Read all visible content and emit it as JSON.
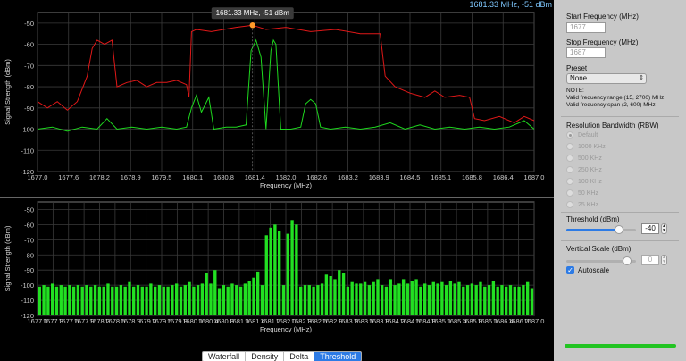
{
  "readout": "1681.33 MHz, -51 dBm",
  "tabs": [
    {
      "label": "Waterfall",
      "active": false
    },
    {
      "label": "Density",
      "active": false
    },
    {
      "label": "Delta",
      "active": false
    },
    {
      "label": "Threshold",
      "active": true
    }
  ],
  "panel": {
    "start_label": "Start Frequency (MHz)",
    "start_placeholder": "1677",
    "stop_label": "Stop Frequency (MHz)",
    "stop_placeholder": "1687",
    "preset_label": "Preset",
    "preset_value": "None",
    "note_title": "NOTE:",
    "note_line1": "Valid frequency range (15, 2700) MHz",
    "note_line2": "Valid frequency span (2, 600) MHz",
    "rbw_label": "Resolution Bandwidth (RBW)",
    "rbw_options": [
      "Default",
      "1000 KHz",
      "500 KHz",
      "250 KHz",
      "100 KHz",
      "50 KHz",
      "25 KHz"
    ],
    "rbw_selected": 0,
    "threshold_label": "Threshold (dBm)",
    "threshold_value": "-40",
    "threshold_level": 0.75,
    "vscale_label": "Vertical Scale (dBm)",
    "vscale_value": "0",
    "vscale_level": 0.87,
    "autoscale_label": "Autoscale",
    "autoscale_checked": true
  },
  "chart_data": [
    {
      "type": "line",
      "tooltip": "1681.33 MHz, -51 dBm",
      "marker": {
        "x": 1681.33,
        "y": -51
      },
      "xlabel": "Frequency (MHz)",
      "ylabel": "Signal Strength (dBm)",
      "xlim": [
        1677.0,
        1687.0
      ],
      "ylim": [
        -120,
        -45
      ],
      "xticks": [
        "1677.0",
        "1677.6",
        "1678.2",
        "1678.9",
        "1679.5",
        "1680.1",
        "1680.8",
        "1681.4",
        "1682.0",
        "1682.6",
        "1683.2",
        "1683.9",
        "1684.5",
        "1685.1",
        "1685.8",
        "1686.4",
        "1687.0"
      ],
      "yticks": [
        -50,
        -60,
        -70,
        -80,
        -90,
        -100,
        -110,
        -120
      ],
      "grid": true,
      "series": [
        {
          "color": "#e01818",
          "x": [
            1677.0,
            1677.2,
            1677.4,
            1677.6,
            1677.8,
            1678.0,
            1678.1,
            1678.2,
            1678.35,
            1678.5,
            1678.6,
            1678.8,
            1679.0,
            1679.2,
            1679.4,
            1679.6,
            1679.8,
            1680.0,
            1680.05,
            1680.1,
            1680.2,
            1680.5,
            1681.0,
            1681.33,
            1681.6,
            1682.0,
            1682.5,
            1683.0,
            1683.5,
            1683.9,
            1684.0,
            1684.2,
            1684.5,
            1684.8,
            1685.0,
            1685.2,
            1685.5,
            1685.7,
            1685.8,
            1686.0,
            1686.3,
            1686.6,
            1686.8,
            1687.0
          ],
          "y": [
            -87,
            -90,
            -87,
            -91,
            -87,
            -75,
            -62,
            -58,
            -60,
            -58,
            -80,
            -78,
            -77,
            -80,
            -78,
            -78,
            -77,
            -79,
            -85,
            -54,
            -53,
            -54,
            -52,
            -51,
            -53,
            -52,
            -54,
            -53,
            -55,
            -55,
            -75,
            -80,
            -83,
            -85,
            -82,
            -85,
            -84,
            -85,
            -95,
            -96,
            -94,
            -97,
            -94,
            -96
          ]
        },
        {
          "color": "#1ed81e",
          "x": [
            1677.0,
            1677.3,
            1677.6,
            1677.9,
            1678.2,
            1678.4,
            1678.6,
            1678.9,
            1679.2,
            1679.5,
            1679.8,
            1680.0,
            1680.1,
            1680.2,
            1680.3,
            1680.45,
            1680.55,
            1680.8,
            1681.0,
            1681.2,
            1681.3,
            1681.4,
            1681.5,
            1681.6,
            1681.7,
            1681.75,
            1681.8,
            1681.9,
            1682.1,
            1682.3,
            1682.4,
            1682.5,
            1682.6,
            1682.7,
            1682.9,
            1683.2,
            1683.5,
            1683.8,
            1684.1,
            1684.4,
            1684.7,
            1685.0,
            1685.3,
            1685.6,
            1685.9,
            1686.2,
            1686.5,
            1686.8,
            1687.0
          ],
          "y": [
            -100,
            -99,
            -101,
            -99,
            -100,
            -95,
            -100,
            -99,
            -100,
            -99,
            -100,
            -99,
            -90,
            -84,
            -92,
            -85,
            -100,
            -99,
            -99,
            -98,
            -63,
            -58,
            -66,
            -100,
            -63,
            -58,
            -60,
            -100,
            -100,
            -99,
            -88,
            -86,
            -88,
            -99,
            -100,
            -99,
            -100,
            -99,
            -97,
            -100,
            -98,
            -100,
            -99,
            -100,
            -99,
            -100,
            -99,
            -96,
            -100
          ]
        }
      ]
    },
    {
      "type": "bar",
      "xlabel": "Frequency (MHz)",
      "ylabel": "Signal Strength (dBm)",
      "xlim": [
        1677.0,
        1687.0
      ],
      "ylim": [
        -120,
        -45
      ],
      "xticks": [
        "1677.0",
        "1677.3",
        "1677.6",
        "1677.9",
        "1678.2",
        "1678.5",
        "1678.9",
        "1679.2",
        "1679.5",
        "1679.8",
        "1680.1",
        "1680.4",
        "1680.8",
        "1681.1",
        "1681.4",
        "1681.7",
        "1682.0",
        "1682.3",
        "1682.6",
        "1682.9",
        "1683.2",
        "1683.5",
        "1683.8",
        "1684.2",
        "1684.5",
        "1684.8",
        "1685.1",
        "1685.4",
        "1685.8",
        "1686.1",
        "1686.4",
        "1686.7",
        "1687.0"
      ],
      "yticks": [
        -50,
        -60,
        -70,
        -80,
        -90,
        -100,
        -110,
        -120
      ],
      "grid": true,
      "color": "#22e022",
      "values": [
        -101,
        -100,
        -101,
        -99,
        -101,
        -100,
        -101,
        -100,
        -101,
        -100,
        -101,
        -100,
        -101,
        -100,
        -101,
        -101,
        -99,
        -101,
        -101,
        -100,
        -101,
        -98,
        -101,
        -100,
        -101,
        -101,
        -99,
        -101,
        -100,
        -101,
        -101,
        -100,
        -99,
        -101,
        -100,
        -98,
        -101,
        -100,
        -99,
        -92,
        -99,
        -90,
        -102,
        -100,
        -101,
        -99,
        -100,
        -101,
        -99,
        -97,
        -95,
        -91,
        -100,
        -67,
        -62,
        -60,
        -64,
        -100,
        -66,
        -57,
        -60,
        -101,
        -100,
        -100,
        -101,
        -100,
        -99,
        -93,
        -94,
        -96,
        -90,
        -92,
        -101,
        -98,
        -99,
        -99,
        -98,
        -100,
        -98,
        -96,
        -100,
        -101,
        -96,
        -100,
        -99,
        -96,
        -99,
        -97,
        -96,
        -101,
        -99,
        -100,
        -98,
        -99,
        -98,
        -100,
        -97,
        -99,
        -98,
        -101,
        -100,
        -99,
        -100,
        -98,
        -101,
        -100,
        -97,
        -101,
        -100,
        -101,
        -100,
        -101,
        -101,
        -100,
        -98,
        -102
      ]
    }
  ]
}
